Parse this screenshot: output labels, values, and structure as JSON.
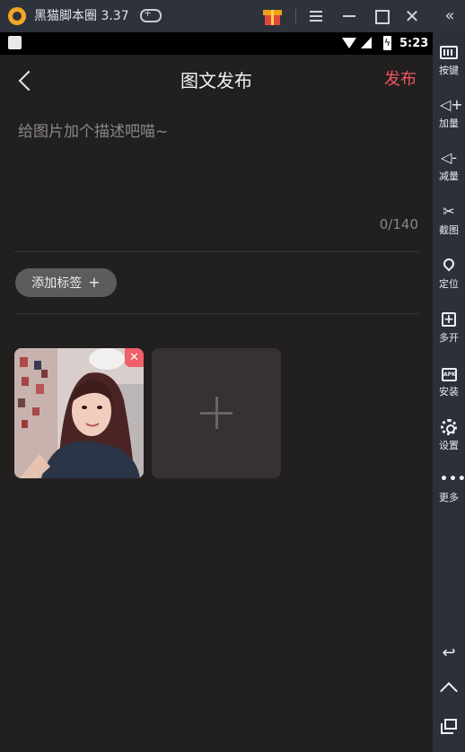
{
  "emulator": {
    "title": "黑猫脚本圈 3.37",
    "window_controls": [
      "menu",
      "minimize",
      "maximize",
      "close",
      "collapse"
    ],
    "icons": {
      "logo": "app-logo",
      "gamepad": "gamepad-icon",
      "gift": "gift-icon",
      "close": "✕",
      "collapse": "«"
    }
  },
  "status_bar": {
    "time": "5:23",
    "icons": [
      "wifi-icon",
      "signal-icon",
      "battery-charging-icon"
    ]
  },
  "app": {
    "page_title": "图文发布",
    "publish_label": "发布",
    "description_placeholder": "给图片加个描述吧喵~",
    "char_counter": "0/140",
    "add_tag_label": "添加标签",
    "add_tag_plus": "+",
    "remove_photo_glyph": "✕",
    "accent_color": "#ef5860"
  },
  "sidebar": {
    "items": [
      {
        "label": "按键",
        "icon": "keyboard-icon"
      },
      {
        "label": "加量",
        "icon": "volume-up-icon",
        "glyph": "◁+"
      },
      {
        "label": "减量",
        "icon": "volume-down-icon",
        "glyph": "◁-"
      },
      {
        "label": "截图",
        "icon": "scissors-icon",
        "glyph": "✂"
      },
      {
        "label": "定位",
        "icon": "location-pin-icon"
      },
      {
        "label": "多开",
        "icon": "multi-instance-icon",
        "glyph": "+"
      },
      {
        "label": "安装",
        "icon": "apk-install-icon",
        "glyph": "APK"
      },
      {
        "label": "设置",
        "icon": "gear-icon"
      },
      {
        "label": "更多",
        "icon": "more-dots-icon",
        "glyph": "•••"
      }
    ],
    "nav": {
      "back_glyph": "↩"
    }
  }
}
